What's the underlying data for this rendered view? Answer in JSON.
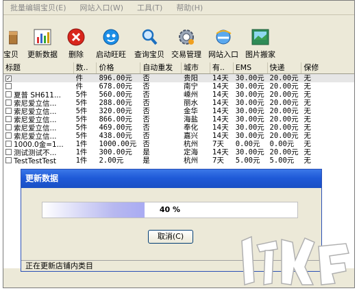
{
  "menu": [
    {
      "label": "批量编辑宝贝"
    },
    {
      "label": "网站入口"
    },
    {
      "label": "工具"
    },
    {
      "label": "帮助"
    }
  ],
  "menu_keys": [
    "(E)",
    "(W)",
    "(T)",
    "(H)"
  ],
  "toolbar": [
    {
      "label": "宝贝",
      "icon": "box-icon"
    },
    {
      "label": "更新数据",
      "icon": "chart-icon"
    },
    {
      "label": "删除",
      "icon": "delete-icon"
    },
    {
      "label": "启动旺旺",
      "icon": "wangwang-icon"
    },
    {
      "label": "查询宝贝",
      "icon": "magnifier-icon"
    },
    {
      "label": "交易管理",
      "icon": "gear-icon"
    },
    {
      "label": "网站入口",
      "icon": "ie-globe-icon"
    },
    {
      "label": "图片搬家",
      "icon": "picture-icon"
    }
  ],
  "table": {
    "columns": [
      "标题",
      "数..",
      "价格",
      "自动重发",
      "城市",
      "有..",
      "EMS",
      "快递",
      "保修"
    ],
    "rows": [
      {
        "checked": true,
        "title": "",
        "qty": "件",
        "price": "896.00元",
        "auto": "否",
        "city": "贵阳",
        "valid": "14天",
        "ems": "30.00元",
        "express": "20.00元",
        "warranty": "无"
      },
      {
        "checked": false,
        "title": "",
        "qty": "件",
        "price": "678.00元",
        "auto": "否",
        "city": "南宁",
        "valid": "14天",
        "ems": "30.00元",
        "express": "20.00元",
        "warranty": "无"
      },
      {
        "checked": false,
        "title": "夏普 SH611...",
        "qty": "5件",
        "price": "560.00元",
        "auto": "否",
        "city": "嵊州",
        "valid": "14天",
        "ems": "30.00元",
        "express": "20.00元",
        "warranty": "无"
      },
      {
        "checked": false,
        "title": "索尼爱立信...",
        "qty": "5件",
        "price": "288.00元",
        "auto": "否",
        "city": "丽水",
        "valid": "14天",
        "ems": "30.00元",
        "express": "20.00元",
        "warranty": "无"
      },
      {
        "checked": false,
        "title": "索尼爱立信...",
        "qty": "5件",
        "price": "320.00元",
        "auto": "否",
        "city": "金华",
        "valid": "14天",
        "ems": "30.00元",
        "express": "20.00元",
        "warranty": "无"
      },
      {
        "checked": false,
        "title": "索尼爱立信...",
        "qty": "5件",
        "price": "866.00元",
        "auto": "否",
        "city": "海盐",
        "valid": "14天",
        "ems": "30.00元",
        "express": "20.00元",
        "warranty": "无"
      },
      {
        "checked": false,
        "title": "索尼爱立信...",
        "qty": "5件",
        "price": "469.00元",
        "auto": "否",
        "city": "奉化",
        "valid": "14天",
        "ems": "30.00元",
        "express": "20.00元",
        "warranty": "无"
      },
      {
        "checked": false,
        "title": "索尼爱立信...",
        "qty": "5件",
        "price": "438.00元",
        "auto": "否",
        "city": "嘉兴",
        "valid": "14天",
        "ems": "30.00元",
        "express": "20.00元",
        "warranty": "无"
      },
      {
        "checked": false,
        "title": "1000.0金=1...",
        "qty": "1件",
        "price": "1000.00元",
        "auto": "否",
        "city": "杭州",
        "valid": "7天",
        "ems": "0.00元",
        "express": "0.00元",
        "warranty": "无"
      },
      {
        "checked": false,
        "title": "测试测试不...",
        "qty": "1件",
        "price": "300.00元",
        "auto": "是",
        "city": "定海",
        "valid": "14天",
        "ems": "30.00元",
        "express": "20.00元",
        "warranty": "无"
      },
      {
        "checked": false,
        "title": "TestTestTest",
        "qty": "1件",
        "price": "2.00元",
        "auto": "是",
        "city": "杭州",
        "valid": "7天",
        "ems": "5.00元",
        "express": "5.00元",
        "warranty": "无"
      }
    ]
  },
  "dialog": {
    "title": "更新数据",
    "progress_percent": 40,
    "progress_text": "40 %",
    "cancel_label": "取消(C)",
    "status": "正在更新店铺内类目"
  }
}
